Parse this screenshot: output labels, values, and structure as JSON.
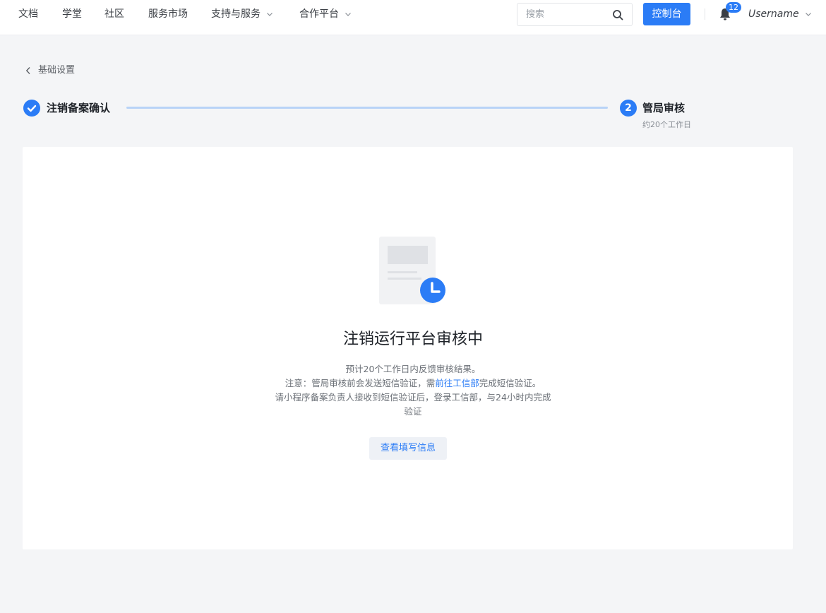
{
  "nav": {
    "items": [
      {
        "label": "文档"
      },
      {
        "label": "学堂"
      },
      {
        "label": "社区"
      },
      {
        "label": "服务市场"
      },
      {
        "label": "支持与服务"
      },
      {
        "label": "合作平台"
      }
    ],
    "search_placeholder": "搜索",
    "console_label": "控制台",
    "notification_count": "12",
    "username": "Username"
  },
  "breadcrumb": {
    "back_label": "基础设置"
  },
  "steps": [
    {
      "title": "注销备案确认",
      "status": "done"
    },
    {
      "number": "2",
      "title": "管局审核",
      "subtitle": "约20个工作日",
      "status": "active"
    }
  ],
  "main": {
    "title": "注销运行平台审核中",
    "line1": "预计20个工作日内反馈审核结果。",
    "line2_prefix": "注意：管局审核前会发送短信验证，需",
    "line2_link": "前往工信部",
    "line2_suffix": "完成短信验证。",
    "line3": "请小程序备案负责人接收到短信验证后，登录工信部，与24小时内完成",
    "line4": "验证",
    "button_label": "查看填写信息"
  },
  "colors": {
    "accent": "#2b7cf6",
    "progress_line": "#b8d3f7",
    "page_bg": "#f4f5f7"
  }
}
